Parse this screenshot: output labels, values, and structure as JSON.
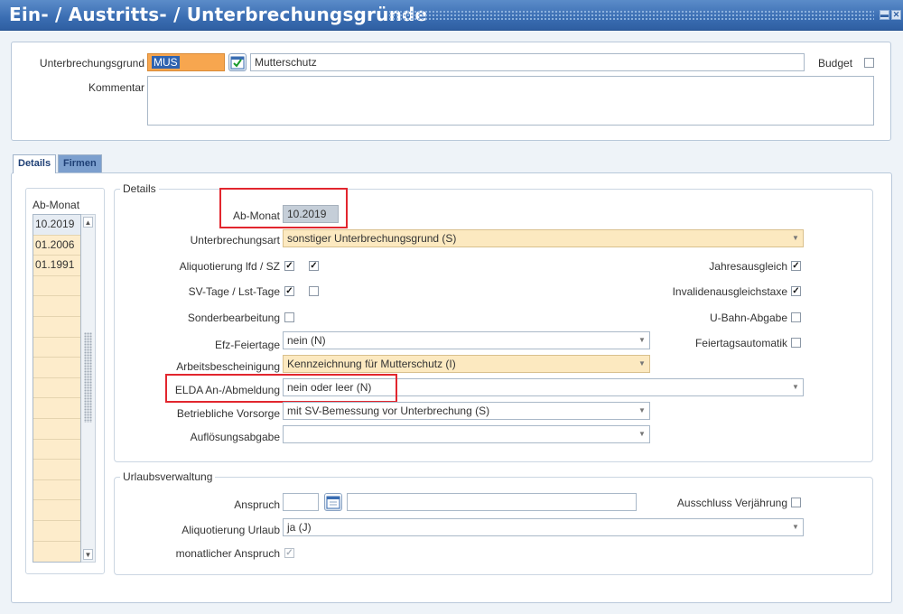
{
  "window": {
    "title": "Ein- / Austritts- / Unterbrechungsgründe"
  },
  "header": {
    "unterbrechungsgrund_label": "Unterbrechungsgrund",
    "unterbrechungsgrund_code": "MUS",
    "unterbrechungsgrund_name": "Mutterschutz",
    "budget_label": "Budget",
    "budget_checked": "",
    "kommentar_label": "Kommentar",
    "kommentar_value": ""
  },
  "tabs": {
    "details": "Details",
    "firmen": "Firmen"
  },
  "list": {
    "header": "Ab-Monat",
    "items": [
      "10.2019",
      "01.2006",
      "01.1991"
    ]
  },
  "details": {
    "legend": "Details",
    "ab_monat_label": "Ab-Monat",
    "ab_monat_value": "10.2019",
    "unterbrechungsart_label": "Unterbrechungsart",
    "unterbrechungsart_value": "sonstiger Unterbrechungsgrund (S)",
    "aliquotierung_label": "Aliquotierung lfd / SZ",
    "svtage_label": "SV-Tage / Lst-Tage",
    "sonderbearbeitung_label": "Sonderbearbeitung",
    "jahresausgleich_label": "Jahresausgleich",
    "invalidenausgleichstaxe_label": "Invalidenausgleichstaxe",
    "ubahn_label": "U-Bahn-Abgabe",
    "feiertagsautomatik_label": "Feiertagsautomatik",
    "efz_label": "Efz-Feiertage",
    "efz_value": "nein (N)",
    "arbeitsbescheinigung_label": "Arbeitsbescheinigung",
    "arbeitsbescheinigung_value": "Kennzeichnung für Mutterschutz (I)",
    "elda_label": "ELDA An-/Abmeldung",
    "elda_value": "nein oder leer (N)",
    "vorsorge_label": "Betriebliche Vorsorge",
    "vorsorge_value": "mit SV-Bemessung vor Unterbrechung (S)",
    "aufloesung_label": "Auflösungsabgabe",
    "aufloesung_value": "",
    "check_mark": "✓"
  },
  "urlaub": {
    "legend": "Urlaubsverwaltung",
    "anspruch_label": "Anspruch",
    "anspruch_value": "",
    "anspruch_text": "",
    "ausschluss_label": "Ausschluss Verjährung",
    "aliquotierung_label": "Aliquotierung Urlaub",
    "aliquotierung_value": "ja (J)",
    "monatlicher_label": "monatlicher Anspruch"
  },
  "icons": [
    "calendar-icon",
    "check-icon",
    "dropdown-arrow-icon",
    "scroll-up-icon",
    "scroll-down-icon",
    "minimize-icon",
    "close-icon"
  ],
  "colors": {
    "titlebar": "#3a6db2",
    "required_field": "#f7a64f",
    "option_field": "#fce9c0",
    "highlight": "#e2262e"
  }
}
